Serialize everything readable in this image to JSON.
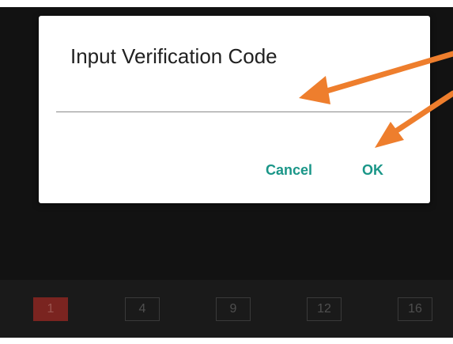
{
  "dialog": {
    "title": "Input Verification Code",
    "input_value": "",
    "cancel_label": "Cancel",
    "ok_label": "OK"
  },
  "channel_bar": {
    "channels": [
      {
        "label": "1",
        "selected": true
      },
      {
        "label": "4",
        "selected": false
      },
      {
        "label": "9",
        "selected": false
      },
      {
        "label": "12",
        "selected": false
      },
      {
        "label": "16",
        "selected": false
      }
    ]
  },
  "colors": {
    "accent": "#1a9688",
    "annotation_arrow": "#ee7e2d",
    "selected_channel": "#7a2420",
    "backdrop": "#121212"
  }
}
